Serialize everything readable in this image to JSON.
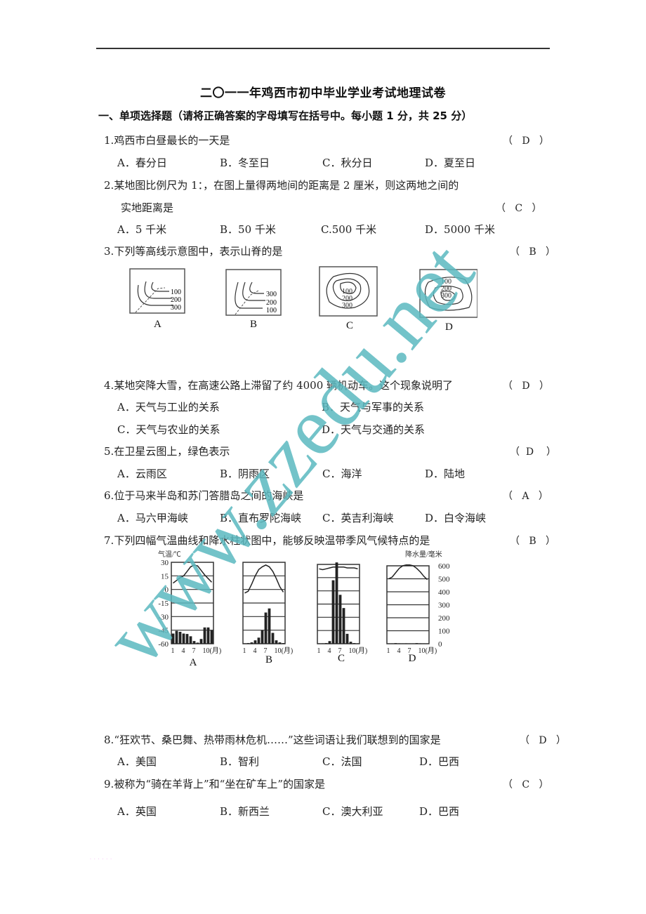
{
  "title": "二〇一一年鸡西市初中毕业学业考试地理试卷",
  "section": "一、单项选择题（请将正确答案的字母填写在括号中。每小题 1 分，共 25 分）",
  "questions": [
    {
      "num": "1.",
      "stem": "鸡西市白昼最长的一天是",
      "answer": "D",
      "options": [
        "A．春分日",
        "B．冬至日",
        "C．秋分日",
        "D．夏至日"
      ]
    },
    {
      "num": "2.",
      "stem": "某地图比例尺为 1：，在图上量得两地间的距离是 2 厘米，则这两地之间的",
      "stem_cont": "实地距离是",
      "answer": "C",
      "options": [
        "A．5 千米",
        "B．50 千米",
        "C.500 千米",
        "D．5000 千米"
      ]
    },
    {
      "num": "3.",
      "stem": "下列等高线示意图中，表示山脊的是",
      "answer": "B",
      "figure_labels": [
        "A",
        "B",
        "C",
        "D"
      ],
      "contour_labels": {
        "A": [
          "100",
          "200",
          "300"
        ],
        "B": [
          "300",
          "200",
          "100"
        ],
        "C": [
          "100",
          "200",
          "300"
        ],
        "D": [
          "100",
          "200",
          "300"
        ]
      }
    },
    {
      "num": "4.",
      "stem": "某地突降大雪，在高速公路上滞留了约 4000 辆机动车。这个现象说明了",
      "answer": "D",
      "options": [
        "A．天气与工业的关系",
        "B．天气与军事的关系",
        "C．天气与农业的关系",
        "D．天气与交通的关系"
      ]
    },
    {
      "num": "5.",
      "stem": "在卫星云图上，绿色表示",
      "answer": "D",
      "options": [
        "A．云雨区",
        "B．阴雨区",
        "C．海洋",
        "D．陆地"
      ]
    },
    {
      "num": "6.",
      "stem": "位于马来半岛和苏门答腊岛之间的海峡是",
      "answer": "A",
      "options": [
        "A．马六甲海峡",
        "B．直布罗陀海峡",
        "C．英吉利海峡",
        "D．白令海峡"
      ]
    },
    {
      "num": "7.",
      "stem": "下列四幅气温曲线和降水柱状图中，能够反映温带季风气候特点的是",
      "answer": "B"
    },
    {
      "num": "8.",
      "stem": "“狂欢节、桑巴舞、热带雨林危机……”这些词语让我们联想到的国家是",
      "answer": "D",
      "options": [
        "A．美国",
        "B．智利",
        "C．法国",
        "D．巴西"
      ]
    },
    {
      "num": "9.",
      "stem": "被称为“骑在羊背上”和“坐在矿车上”的国家是",
      "answer": "C",
      "options": [
        "A．英国",
        "B．新西兰",
        "C．澳大利亚",
        "D．巴西"
      ]
    }
  ],
  "paren_open": "（",
  "paren_close": "）",
  "watermark": "www.zzedu.net",
  "chart_data": [
    {
      "type": "bar+line",
      "title": "A",
      "xlabel": "(月)",
      "ylabel_left": "气温/℃",
      "ylabel_right": "降水量/毫米",
      "x": [
        1,
        2,
        3,
        4,
        5,
        6,
        7,
        8,
        9,
        10,
        11,
        12
      ],
      "x_ticks": [
        "1",
        "4",
        "7",
        "10(月)"
      ],
      "ylim_left": [
        -60,
        30
      ],
      "yticks_left": [
        "30",
        "15",
        "0",
        "-15",
        "-30",
        "-45",
        "-60"
      ],
      "ylim_right": [
        0,
        600
      ],
      "yticks_right": [
        "600",
        "500",
        "400",
        "300",
        "200",
        "100",
        "0"
      ],
      "series": [
        {
          "name": "气温",
          "kind": "line",
          "values": [
            7,
            10,
            13,
            15,
            20,
            25,
            27,
            26,
            21,
            16,
            12,
            8
          ]
        },
        {
          "name": "降水量",
          "kind": "bar",
          "values": [
            75,
            95,
            88,
            75,
            72,
            55,
            20,
            8,
            35,
            120,
            120,
            100
          ]
        }
      ],
      "grid": true
    },
    {
      "type": "bar+line",
      "title": "B",
      "xlabel": "(月)",
      "x": [
        1,
        2,
        3,
        4,
        5,
        6,
        7,
        8,
        9,
        10,
        11,
        12
      ],
      "x_ticks": [
        "1",
        "4",
        "7",
        "10(月)"
      ],
      "ylim_left": [
        -60,
        30
      ],
      "ylim_right": [
        0,
        600
      ],
      "series": [
        {
          "name": "气温",
          "kind": "line",
          "values": [
            -4,
            -2,
            6,
            15,
            22,
            25,
            27,
            25,
            20,
            12,
            3,
            -3
          ]
        },
        {
          "name": "降水量",
          "kind": "bar",
          "values": [
            3,
            5,
            10,
            25,
            45,
            100,
            230,
            260,
            80,
            25,
            10,
            5
          ]
        }
      ],
      "grid": true
    },
    {
      "type": "bar+line",
      "title": "C",
      "xlabel": "(月)",
      "x": [
        1,
        2,
        3,
        4,
        5,
        6,
        7,
        8,
        9,
        10,
        11,
        12
      ],
      "x_ticks": [
        "1",
        "4",
        "7",
        "10(月)"
      ],
      "ylim_left": [
        -60,
        30
      ],
      "ylim_right": [
        0,
        600
      ],
      "series": [
        {
          "name": "气温",
          "kind": "line",
          "values": [
            25,
            24,
            25,
            26,
            27,
            27,
            27,
            27,
            26,
            26,
            26,
            25
          ]
        },
        {
          "name": "降水量",
          "kind": "bar",
          "values": [
            3,
            3,
            5,
            20,
            480,
            620,
            370,
            270,
            75,
            15,
            5,
            3
          ]
        }
      ],
      "grid": true
    },
    {
      "type": "bar+line",
      "title": "D",
      "xlabel": "(月)",
      "x": [
        1,
        2,
        3,
        4,
        5,
        6,
        7,
        8,
        9,
        10,
        11,
        12
      ],
      "x_ticks": [
        "1",
        "4",
        "7",
        "10(月)"
      ],
      "ylim_left": [
        -60,
        30
      ],
      "ylim_right": [
        0,
        600
      ],
      "series": [
        {
          "name": "气温",
          "kind": "line",
          "values": [
            15,
            17,
            22,
            27,
            30,
            31,
            31,
            30,
            27,
            23,
            18,
            14
          ]
        },
        {
          "name": "降水量",
          "kind": "bar",
          "values": [
            2,
            2,
            5,
            3,
            2,
            3,
            2,
            2,
            5,
            3,
            2,
            2
          ]
        }
      ],
      "grid": true
    }
  ]
}
